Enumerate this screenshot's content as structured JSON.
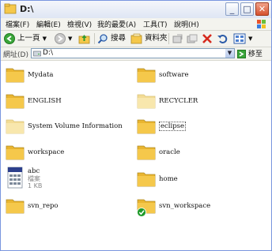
{
  "window": {
    "title": "D:\\"
  },
  "menu": [
    "檔案(F)",
    "編輯(E)",
    "檢視(V)",
    "我的最愛(A)",
    "工具(T)",
    "說明(H)"
  ],
  "toolbar": {
    "back_label": "上一頁",
    "search_label": "搜尋",
    "folders_label": "資料夾"
  },
  "address": {
    "label": "網址(D)",
    "value": "D:\\",
    "go_label": "移至"
  },
  "items": [
    {
      "name": "Mydata",
      "kind": "folder"
    },
    {
      "name": "software",
      "kind": "folder"
    },
    {
      "name": "ENGLISH",
      "kind": "folder"
    },
    {
      "name": "RECYCLER",
      "kind": "folder-hidden"
    },
    {
      "name": "System Volume Information",
      "kind": "folder-hidden"
    },
    {
      "name": "eclipse",
      "kind": "folder"
    },
    {
      "name": "workspace",
      "kind": "folder"
    },
    {
      "name": "oracle",
      "kind": "folder"
    },
    {
      "name": "abc",
      "kind": "file",
      "type": "檔案",
      "size": "1 KB"
    },
    {
      "name": "home",
      "kind": "folder"
    },
    {
      "name": "svn_repo",
      "kind": "folder"
    },
    {
      "name": "svn_workspace",
      "kind": "folder-svn"
    }
  ],
  "colors": {
    "folder": "#f5c84b",
    "folder_hidden": "#f8e7ad",
    "titlebar": "#dfe6f4",
    "chrome": "#f3f3ee"
  }
}
